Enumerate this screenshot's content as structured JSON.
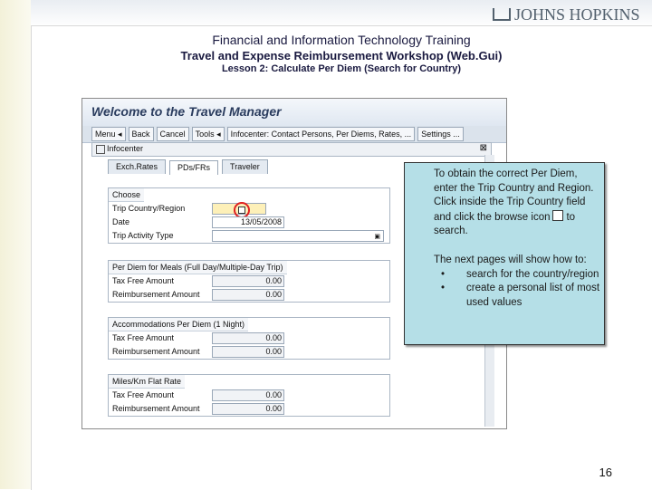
{
  "header": {
    "logo_text": "JOHNS HOPKINS",
    "title": "Financial and Information Technology Training",
    "subtitle": "Travel and Expense Reimbursement Workshop (Web.Gui)",
    "lesson": "Lesson 2: Calculate Per Diem (Search for Country)"
  },
  "sap": {
    "window_title": "Welcome to the Travel Manager",
    "menu": [
      "Menu ◂",
      "Back",
      "Cancel",
      "Tools ◂",
      "Infocenter: Contact Persons, Per Diems, Rates, ...",
      "Settings ..."
    ],
    "infocenter_label": "Infocenter",
    "tabs": [
      "Exch.Rates",
      "PDs/FRs",
      "Traveler"
    ],
    "active_tab": 1,
    "choose": {
      "heading": "Choose",
      "trip_country_label": "Trip Country/Region",
      "date_label": "Date",
      "date_value": "13/05/2008",
      "activity_label": "Trip Activity Type"
    },
    "meals": {
      "heading": "Per Diem for Meals (Full Day/Multiple-Day Trip)",
      "tax_free_label": "Tax Free Amount",
      "tax_free_value": "0.00",
      "reimb_label": "Reimbursement Amount",
      "reimb_value": "0.00"
    },
    "accommodations": {
      "heading": "Accommodations Per Diem (1 Night)",
      "tax_free_label": "Tax Free Amount",
      "tax_free_value": "0.00",
      "reimb_label": "Reimbursement Amount",
      "reimb_value": "0.00"
    },
    "miles": {
      "heading": "Miles/Km Flat Rate",
      "tax_free_label": "Tax Free Amount",
      "tax_free_value": "0.00",
      "reimb_label": "Reimbursement Amount",
      "reimb_value": "0.00"
    }
  },
  "callout": {
    "para1_before_icon": "To obtain the correct Per Diem, enter the Trip Country and Region. Click inside the Trip Country field and click the browse icon",
    "para1_after_icon": "to search.",
    "para2": "The next pages will show how to:",
    "bullets": [
      "search for the country/region",
      "create a personal list of most used values"
    ]
  },
  "page_number": "16"
}
